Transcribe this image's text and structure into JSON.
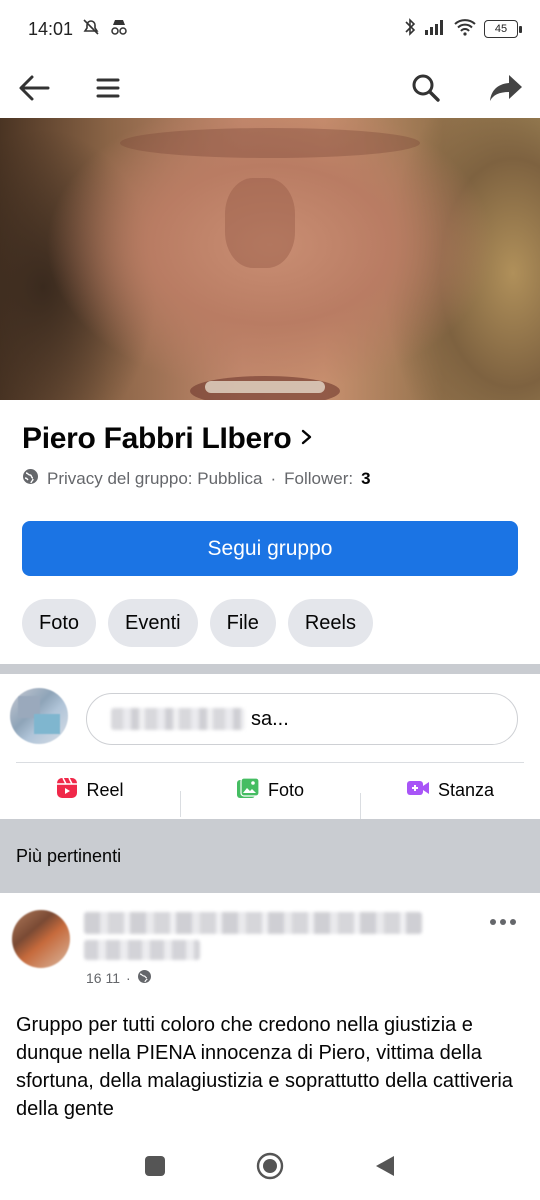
{
  "status_bar": {
    "time": "14:01",
    "battery": "45",
    "icons": [
      "muted-icon",
      "incognito-icon",
      "bluetooth-icon",
      "signal-icon",
      "wifi-icon",
      "battery-icon"
    ]
  },
  "top_nav": {
    "icons": [
      "back-arrow-icon",
      "menu-icon",
      "search-icon",
      "share-icon"
    ]
  },
  "group": {
    "name": "Piero Fabbri LIbero",
    "privacy_label": "Privacy del gruppo: Pubblica",
    "separator": "·",
    "followers_label": "Follower:",
    "followers_count": "3",
    "follow_button": "Segui gruppo",
    "tabs": [
      "Foto",
      "Eventi",
      "File",
      "Reels"
    ]
  },
  "composer": {
    "placeholder_visible": "sa...",
    "actions": [
      {
        "label": "Reel",
        "icon": "reel-icon",
        "color": "#f02849"
      },
      {
        "label": "Foto",
        "icon": "photo-icon",
        "color": "#45bd62"
      },
      {
        "label": "Stanza",
        "icon": "video-room-icon",
        "color": "#a855f7"
      }
    ]
  },
  "feed": {
    "section_title": "Più pertinenti",
    "post": {
      "meta_time": "16 11",
      "meta_separator": "·",
      "text": "Gruppo per tutti coloro che credono nella giustizia e dunque nella PIENA innocenza di Piero, vittima della sfortuna, della malagiustizia e soprattutto della cattiveria della gente"
    }
  },
  "colors": {
    "primary": "#1b74e4",
    "chip_bg": "#e4e6eb",
    "secondary_text": "#65676b",
    "divider": "#c9ccd1"
  }
}
